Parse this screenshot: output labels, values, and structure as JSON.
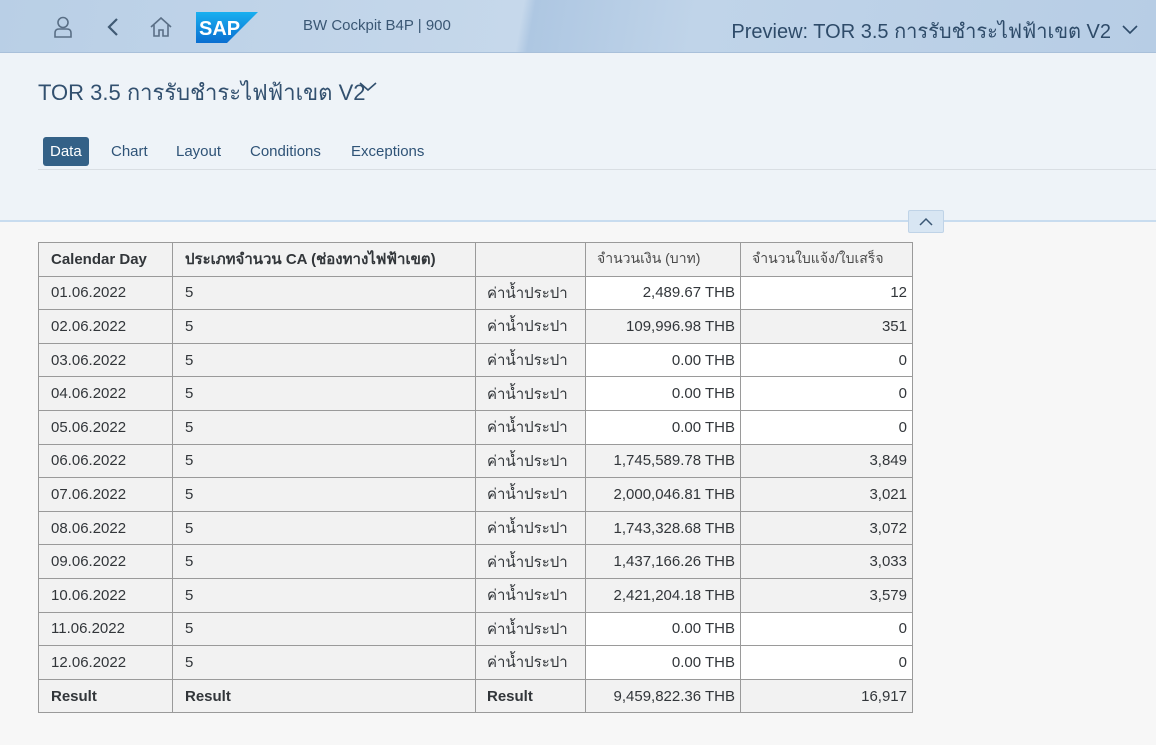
{
  "shell": {
    "system_title": "BW Cockpit B4P | 900",
    "app_title": "Preview: TOR 3.5 การรับชำระไฟฟ้าเขต V2",
    "logo_text": "SAP"
  },
  "header": {
    "title": "TOR 3.5 การรับชำระไฟฟ้าเขต V2",
    "tabs": [
      {
        "label": "Data"
      },
      {
        "label": "Chart"
      },
      {
        "label": "Layout"
      },
      {
        "label": "Conditions"
      },
      {
        "label": "Exceptions"
      }
    ]
  },
  "table": {
    "headers": [
      "Calendar Day",
      "ประเภทจำนวน CA (ช่องทางไฟฟ้าเขต)",
      "",
      "จำนวนเงิน (บาท)",
      "จำนวนใบแจ้ง/ใบเสร็จ"
    ],
    "rows": [
      {
        "day": "01.06.2022",
        "ca": "5",
        "type": "ค่าน้ำประปา",
        "amount": "2,489.67 THB",
        "count": "12"
      },
      {
        "day": "02.06.2022",
        "ca": "5",
        "type": "ค่าน้ำประปา",
        "amount": "109,996.98 THB",
        "count": "351"
      },
      {
        "day": "03.06.2022",
        "ca": "5",
        "type": "ค่าน้ำประปา",
        "amount": "0.00 THB",
        "count": "0"
      },
      {
        "day": "04.06.2022",
        "ca": "5",
        "type": "ค่าน้ำประปา",
        "amount": "0.00 THB",
        "count": "0"
      },
      {
        "day": "05.06.2022",
        "ca": "5",
        "type": "ค่าน้ำประปา",
        "amount": "0.00 THB",
        "count": "0"
      },
      {
        "day": "06.06.2022",
        "ca": "5",
        "type": "ค่าน้ำประปา",
        "amount": "1,745,589.78 THB",
        "count": "3,849"
      },
      {
        "day": "07.06.2022",
        "ca": "5",
        "type": "ค่าน้ำประปา",
        "amount": "2,000,046.81 THB",
        "count": "3,021"
      },
      {
        "day": "08.06.2022",
        "ca": "5",
        "type": "ค่าน้ำประปา",
        "amount": "1,743,328.68 THB",
        "count": "3,072"
      },
      {
        "day": "09.06.2022",
        "ca": "5",
        "type": "ค่าน้ำประปา",
        "amount": "1,437,166.26 THB",
        "count": "3,033"
      },
      {
        "day": "10.06.2022",
        "ca": "5",
        "type": "ค่าน้ำประปา",
        "amount": "2,421,204.18 THB",
        "count": "3,579"
      },
      {
        "day": "11.06.2022",
        "ca": "5",
        "type": "ค่าน้ำประปา",
        "amount": "0.00 THB",
        "count": "0"
      },
      {
        "day": "12.06.2022",
        "ca": "5",
        "type": "ค่าน้ำประปา",
        "amount": "0.00 THB",
        "count": "0"
      }
    ],
    "result": {
      "day": "Result",
      "ca": "Result",
      "type": "Result",
      "amount": "9,459,822.36 THB",
      "count": "16,917"
    }
  },
  "icons": {
    "user": "user-icon",
    "back": "back-icon",
    "home": "home-icon",
    "title_dropdown": "chevron-down-icon",
    "collapse": "chevron-up-icon"
  },
  "colors": {
    "shell_bg": "#c6d8eb",
    "header_bg": "#eef3f8",
    "tab_active": "#346187",
    "sap_logo": "#0a6ed1"
  }
}
